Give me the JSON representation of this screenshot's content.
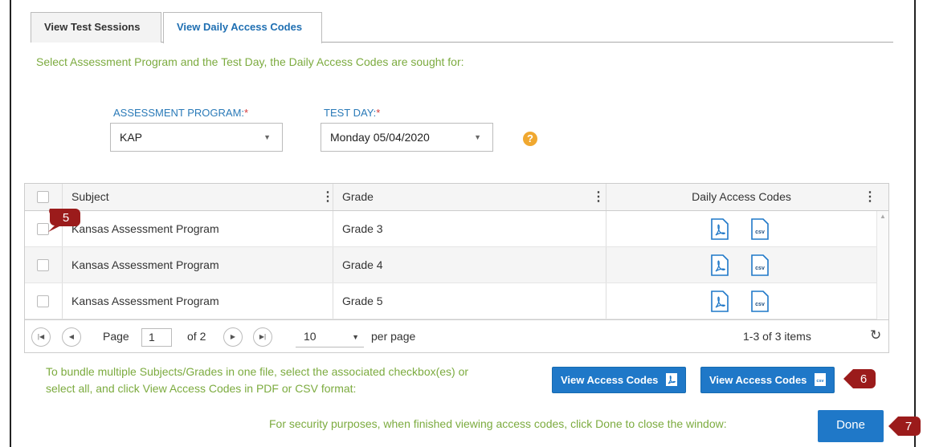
{
  "tabs": [
    {
      "label": "View Test Sessions",
      "active": false
    },
    {
      "label": "View Daily Access Codes",
      "active": true
    }
  ],
  "intro_text": "Select Assessment Program and the Test Day, the Daily Access Codes are sought for:",
  "filters": {
    "program_label": "ASSESSMENT PROGRAM:",
    "program_value": "KAP",
    "day_label": "TEST DAY:",
    "day_value": "Monday 05/04/2020",
    "required_mark": "*",
    "help_glyph": "?"
  },
  "grid": {
    "columns": [
      "Subject",
      "Grade",
      "Daily Access Codes"
    ],
    "rows": [
      {
        "subject": "Kansas Assessment Program",
        "grade": "Grade 3"
      },
      {
        "subject": "Kansas Assessment Program",
        "grade": "Grade 4"
      },
      {
        "subject": "Kansas Assessment Program",
        "grade": "Grade 5"
      }
    ],
    "csv_text": "csv"
  },
  "pager": {
    "page_label": "Page",
    "page_value": "1",
    "of_label": "of 2",
    "page_size": "10",
    "per_page_label": "per page",
    "items_summary": "1-3 of 3 items"
  },
  "bundle_text_1": "To bundle multiple Subjects/Grades in one file, select the associated checkbox(es) or",
  "bundle_text_2": "select all, and click View Access Codes in PDF or CSV format:",
  "buttons": {
    "view_pdf": "View Access Codes",
    "view_csv": "View Access Codes",
    "done": "Done"
  },
  "security_text": "For security purposes, when finished viewing access codes, click Done to close the window:",
  "callouts": [
    "5",
    "6",
    "7"
  ],
  "colors": {
    "accent_blue": "#1f78c8",
    "instruction_green": "#7cab3f",
    "callout_red": "#9b1b1b"
  }
}
